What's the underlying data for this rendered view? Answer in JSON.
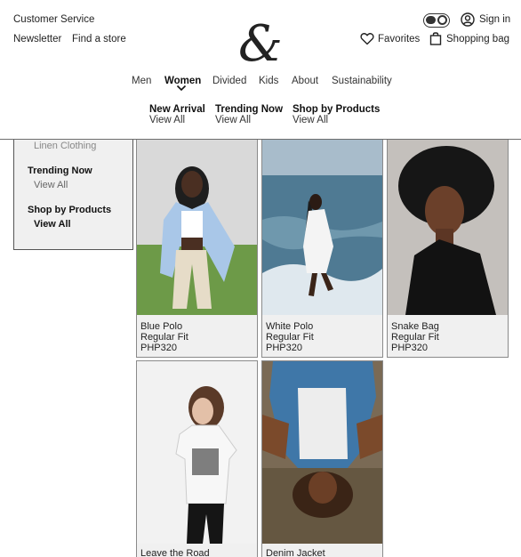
{
  "header": {
    "customer_service": "Customer Service",
    "newsletter": "Newsletter",
    "find_store": "Find a store",
    "logo_text": "&",
    "sign_in": "Sign in",
    "favorites": "Favorites",
    "shopping_bag": "Shopping bag"
  },
  "nav": {
    "items": [
      "Men",
      "Women",
      "Divided",
      "Kids",
      "About",
      "Sustainability"
    ],
    "active": "Women"
  },
  "submenu": [
    {
      "title": "New Arrival",
      "link": "View All"
    },
    {
      "title": "Trending Now",
      "link": "View All"
    },
    {
      "title": "Shop by Products",
      "link": "View All"
    }
  ],
  "sidebar": {
    "linen": "Linen Clothing",
    "trending_title": "Trending Now",
    "trending_link": "View All",
    "shop_title": "Shop by Products",
    "shop_link": "View All"
  },
  "products": [
    {
      "name": "Blue Polo",
      "fit": "Regular Fit",
      "price": "PHP320"
    },
    {
      "name": "White Polo",
      "fit": "Regular Fit",
      "price": "PHP320"
    },
    {
      "name": "Snake Bag",
      "fit": "Regular Fit",
      "price": "PHP320"
    },
    {
      "name": "Leave the Road",
      "fit": "",
      "price": ""
    },
    {
      "name": "Denim Jacket",
      "fit": "",
      "price": ""
    }
  ],
  "colors": {
    "panel_bg": "#f0f0f0",
    "border": "#555555",
    "text": "#1a1a1a"
  }
}
